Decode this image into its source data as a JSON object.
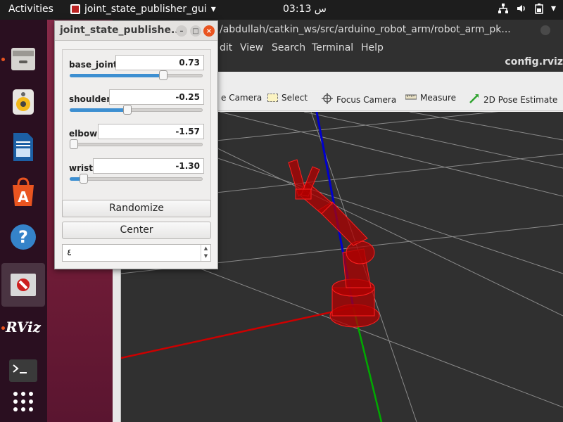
{
  "topbar": {
    "activities": "Activities",
    "app_name": "joint_state_publisher_gui",
    "clock": "03:13 س"
  },
  "dock": {
    "items": [
      "files-icon",
      "rhythmbox-icon",
      "writer-icon",
      "software-icon",
      "help-icon",
      "rviz-window-icon",
      "rviz-icon",
      "terminal-icon",
      "apps-grid-icon"
    ],
    "rviz_label": "RViz"
  },
  "rviz": {
    "title": "/abdullah/catkin_ws/src/arduino_robot_arm/robot_arm_pk...",
    "menu": [
      "dit",
      "View",
      "Search",
      "Terminal",
      "Help"
    ],
    "filename": "config.rviz",
    "tools": [
      "e Camera",
      "Select",
      "Focus Camera",
      "Measure",
      "2D Pose Estimate"
    ]
  },
  "jsp": {
    "title": "joint_state_publishe...",
    "joints": [
      {
        "name": "base_joint",
        "value": "0.73",
        "fraction": 0.72
      },
      {
        "name": "shoulder",
        "value": "-0.25",
        "fraction": 0.43
      },
      {
        "name": "elbow",
        "value": "-1.57",
        "fraction": 0.0
      },
      {
        "name": "wrist",
        "value": "-1.30",
        "fraction": 0.08
      }
    ],
    "randomize": "Randomize",
    "center": "Center",
    "spin_value": "٤"
  },
  "colors": {
    "accent": "#e95420",
    "slider": "#3d8fd1",
    "x_axis": "#cc0000",
    "y_axis": "#00aa00",
    "z_axis": "#0000cc",
    "robot": "#cc0000"
  }
}
